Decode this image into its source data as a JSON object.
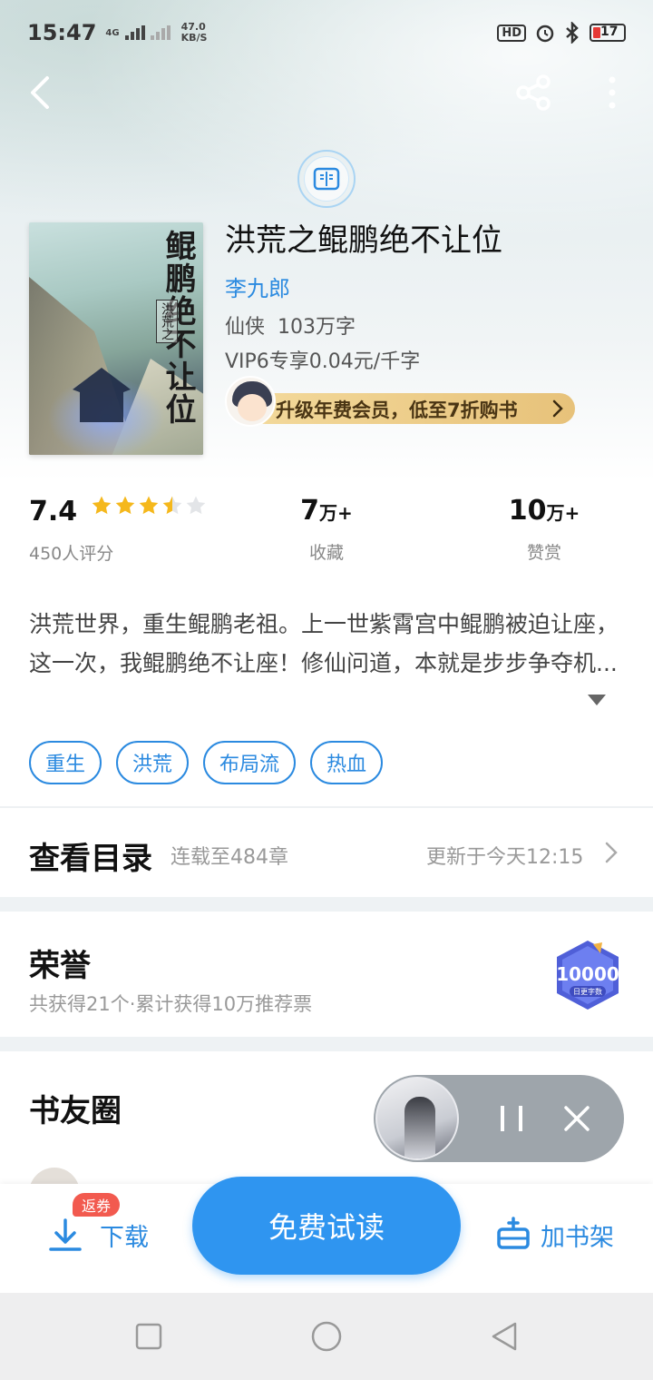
{
  "status_bar": {
    "time": "15:47",
    "network": "4G",
    "speed_value": "47.0",
    "speed_unit": "KB/S",
    "hd_label": "HD",
    "battery": "17"
  },
  "book": {
    "cover_title": "鲲鹏绝不让位",
    "cover_subtitle": "洪荒之",
    "title": "洪荒之鲲鹏绝不让位",
    "author": "李九郎",
    "genre": "仙侠",
    "word_count": "103万字",
    "price": "VIP6专享0.04元/千字",
    "vip_promo": "升级年费会员，低至7折购书"
  },
  "stats": {
    "rating": "7.4",
    "rating_stars": 3.5,
    "rating_count": "450人评分",
    "favorites_value": "7",
    "favorites_unit": "万+",
    "favorites_label": "收藏",
    "rewards_value": "10",
    "rewards_unit": "万+",
    "rewards_label": "赞赏"
  },
  "description": "洪荒世界，重生鲲鹏老祖。上一世紫霄宫中鲲鹏被迫让座，这一次，我鲲鹏绝不让座！修仙问道，本就是步步争夺机...",
  "tags": [
    "重生",
    "洪荒",
    "布局流",
    "热血"
  ],
  "toc": {
    "title": "查看目录",
    "progress": "连载至484章",
    "updated": "更新于今天12:15"
  },
  "honor": {
    "title": "荣誉",
    "summary": "共获得21个·累计获得10万推荐票",
    "badge_number": "10000",
    "badge_label": "日更字数"
  },
  "circle": {
    "title": "书友圈"
  },
  "bottom_bar": {
    "download_label": "下载",
    "coupon_badge": "返券",
    "read_label": "免费试读",
    "shelf_label": "加书架"
  },
  "colors": {
    "accent": "#2b8ae0",
    "primary_button": "#2f95f0",
    "star": "#f5b81c",
    "coupon_badge": "#f25a4f",
    "vip_gold": "#e7c27a"
  }
}
